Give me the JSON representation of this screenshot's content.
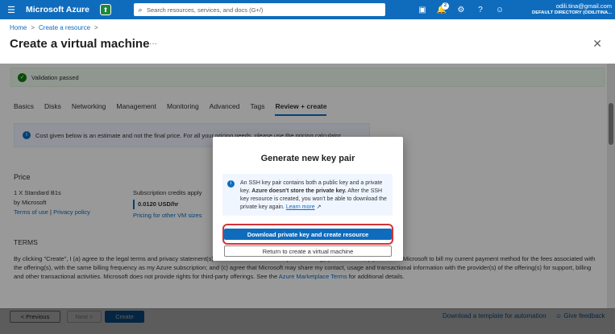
{
  "topbar": {
    "brand": "Microsoft Azure",
    "search_placeholder": "Search resources, services, and docs (G+/)",
    "notification_count": "2",
    "account_email": "odili.tina@gmail.com",
    "account_directory": "DEFAULT DIRECTORY (ODILITINA..."
  },
  "breadcrumb": [
    "Home",
    "Create a resource"
  ],
  "page": {
    "title": "Create a virtual machine"
  },
  "validation": {
    "text": "Validation passed"
  },
  "tabs": [
    "Basics",
    "Disks",
    "Networking",
    "Management",
    "Monitoring",
    "Advanced",
    "Tags",
    "Review + create"
  ],
  "info_banner": {
    "text": "Cost given below is an estimate and not the final price. For all your pricing needs, please use the pricing calculator."
  },
  "price": {
    "heading": "Price",
    "sku": "1 X Standard B1s",
    "by": "by Microsoft",
    "terms_link": "Terms of use",
    "privacy_link": "Privacy policy",
    "credits_label": "Subscription credits apply",
    "hourly": "0.0120 USD/hr",
    "other_sizes_link": "Pricing for other VM sizes"
  },
  "terms": {
    "heading": "TERMS",
    "body": "By clicking \"Create\", I (a) agree to the legal terms and privacy statement(s) associated with the Marketplace offering(s) listed above; (b) authorize Microsoft to bill my current payment method for the fees associated with the offering(s), with the same billing frequency as my Azure subscription; and (c) agree that Microsoft may share my contact, usage and transactional information with the provider(s) of the offering(s) for support, billing and other transactional activities. Microsoft does not provide rights for third-party offerings. See the",
    "marketplace_link": "Azure Marketplace Terms",
    "tail": "for additional details."
  },
  "footer": {
    "previous": "< Previous",
    "next": "Next >",
    "create": "Create",
    "download_template": "Download a template for automation",
    "feedback": "Give feedback"
  },
  "dialog": {
    "title": "Generate new key pair",
    "info_part1": "An SSH key pair contains both a public key and a private key.",
    "info_bold": "Azure doesn't store the private key.",
    "info_part2": "After the SSH key resource is created, you won't be able to download the private key again.",
    "learn_more": "Learn more",
    "download_button": "Download private key and create resource",
    "return_button": "Return to create a virtual machine"
  },
  "colors": {
    "accent": "#0f6cbd",
    "success": "#107c10",
    "highlight": "#d13438"
  }
}
